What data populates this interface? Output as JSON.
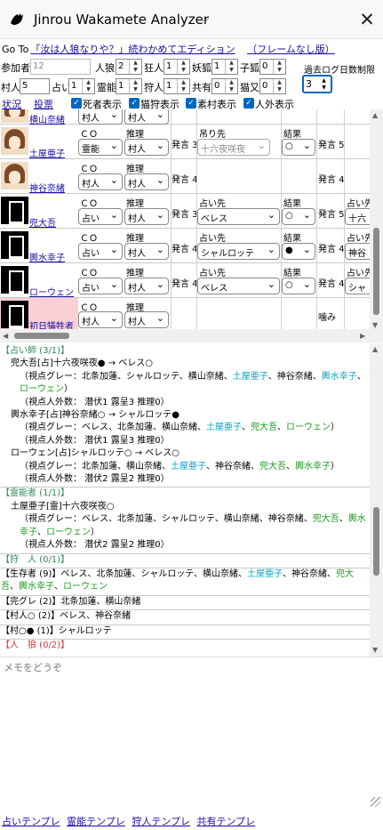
{
  "title": "Jinrou Wakamete Analyzer",
  "goto": {
    "prefix": "Go To",
    "link1": "「汝は人狼なりや？」続わかめてエディション",
    "link2": "（フレームなし版）"
  },
  "counts": {
    "participants": {
      "label": "参加者",
      "value": "12"
    },
    "wolf": {
      "label": "人狼",
      "value": "2"
    },
    "madman": {
      "label": "狂人",
      "value": "1"
    },
    "fox": {
      "label": "妖狐",
      "value": "1"
    },
    "fox_child": {
      "label": "子狐",
      "value": "0"
    },
    "villager": {
      "label": "村人",
      "value": "5"
    },
    "seer": {
      "label": "占い",
      "value": "1"
    },
    "medium": {
      "label": "霊能",
      "value": "1"
    },
    "hunter": {
      "label": "狩人",
      "value": "1"
    },
    "mason": {
      "label": "共有",
      "value": "0"
    },
    "cat": {
      "label": "猫又",
      "value": "0"
    }
  },
  "past_log": {
    "label": "過去ログ日数制限",
    "value": "3"
  },
  "nav": {
    "status": "状況",
    "vote": "投票",
    "show_dead": "死者表示",
    "show_cat_hunter": "猫狩表示",
    "show_plain": "素村表示",
    "show_nonhuman": "人外表示"
  },
  "labels": {
    "co": "ＣＯ",
    "reason": "推理",
    "hanging": "吊り先",
    "divine": "占い先",
    "result": "結果",
    "speech": "発言"
  },
  "players": [
    {
      "name": "横山奈緒",
      "co": "村人",
      "reason": "村人",
      "speech": "",
      "target": "",
      "result": "",
      "speech2": "",
      "extra": "",
      "avatar": "girl"
    },
    {
      "name": "土屋亜子",
      "co": "霊能",
      "reason": "村人",
      "speech": "発言 3",
      "target": "十六夜咲夜",
      "result": "○",
      "speech2": "発言 5",
      "extra": "",
      "avatar": "girl",
      "target_label": "吊り先"
    },
    {
      "name": "神谷奈緒",
      "co": "村人",
      "reason": "村人",
      "speech": "発言 4",
      "target": "",
      "result": "",
      "speech2": "発言 4",
      "extra": "",
      "avatar": "girl"
    },
    {
      "name": "兜大吾",
      "co": "占い",
      "reason": "村人",
      "speech": "発言 3",
      "target": "ベレス",
      "result": "○",
      "speech2": "発言 5",
      "extra": "十六",
      "avatar": "blk",
      "target_label": "占い先"
    },
    {
      "name": "輿水幸子",
      "co": "占い",
      "reason": "村人",
      "speech": "発言 4",
      "target": "シャルロッテ",
      "result": "●",
      "speech2": "発言 4",
      "extra": "神谷",
      "avatar": "blk",
      "target_label": "占い先"
    },
    {
      "name": "ローウェン",
      "co": "占い",
      "reason": "村人",
      "speech": "発言 4",
      "target": "ベレス",
      "result": "○",
      "speech2": "発言 4",
      "extra": "シャ",
      "avatar": "blk",
      "target_label": "占い先"
    },
    {
      "name": "初日犠牲者",
      "co": "村人",
      "reason": "村人",
      "speech": "",
      "target": "",
      "result": "",
      "speech2": "噛み",
      "extra": "",
      "avatar": "blk"
    }
  ],
  "analysis": {
    "seer_header": "【占い師 (3/1)】",
    "seer_blocks": [
      {
        "line": "兜大吾[占]十六夜咲夜● → ベレス○",
        "grey": [
          "北条加蓮",
          "シャルロッテ",
          "横山奈緒",
          "土屋亜子",
          "神谷奈緒",
          "輿水幸子",
          "ローウェン"
        ],
        "outside": "（視点人外数： 潜伏1 露呈3 推理0）"
      },
      {
        "line": "輿水幸子[占]神谷奈緒○ → シャルロッテ●",
        "grey": [
          "ベレス",
          "北条加蓮",
          "横山奈緒",
          "土屋亜子",
          "兜大吾",
          "ローウェン"
        ],
        "outside": "（視点人外数： 潜伏1 露呈3 推理0）"
      },
      {
        "line": "ローウェン[占]シャルロッテ○ → ベレス○",
        "grey": [
          "北条加蓮",
          "横山奈緒",
          "土屋亜子",
          "神谷奈緒",
          "兜大吾",
          "輿水幸子"
        ],
        "outside": "（視点人外数： 潜伏2 露呈2 推理0）"
      }
    ],
    "medium_header": "【霊能者 (1/1)】",
    "medium_blocks": [
      {
        "line": "土屋亜子[霊]十六夜咲夜○",
        "grey": [
          "ベレス",
          "北条加蓮",
          "シャルロッテ",
          "横山奈緒",
          "神谷奈緒",
          "兜大吾",
          "輿水幸子",
          "ローウェン"
        ],
        "outside": "（視点人外数： 潜伏2 露呈2 推理0）"
      }
    ],
    "hunter_header": "【狩　人 (0/1)】",
    "survivors_prefix": "【生存者 (9)】",
    "survivors": [
      "ベレス",
      "北条加蓮",
      "シャルロッテ",
      "横山奈緒",
      "土屋亜子",
      "神谷奈緒",
      "兜大吾",
      "輿水幸子",
      "ローウェン"
    ],
    "complete_grey": "【完グレ (2)】北条加蓮、横山奈緒",
    "villager_white": "【村人○ (2)】ベレス、神谷奈緒",
    "villager_mixed": "【村○● (1)】シャルロッテ",
    "cut_line": "【人　狼 (0/2)】",
    "grey_prefix": "（視点グレー：",
    "grey_suffix": "）"
  },
  "memo_placeholder": "メモをどうぞ",
  "templates": [
    "占いテンプレ",
    "霊能テンプレ",
    "狩人テンプレ",
    "共有テンプレ"
  ],
  "colors": {
    "link": "#1a0dab",
    "cyan": "#0aa4c8",
    "green": "#1e9a1e",
    "header_green": "#2e8b57",
    "dead_bg": "#fbd0d4",
    "accent": "#0067c0"
  }
}
